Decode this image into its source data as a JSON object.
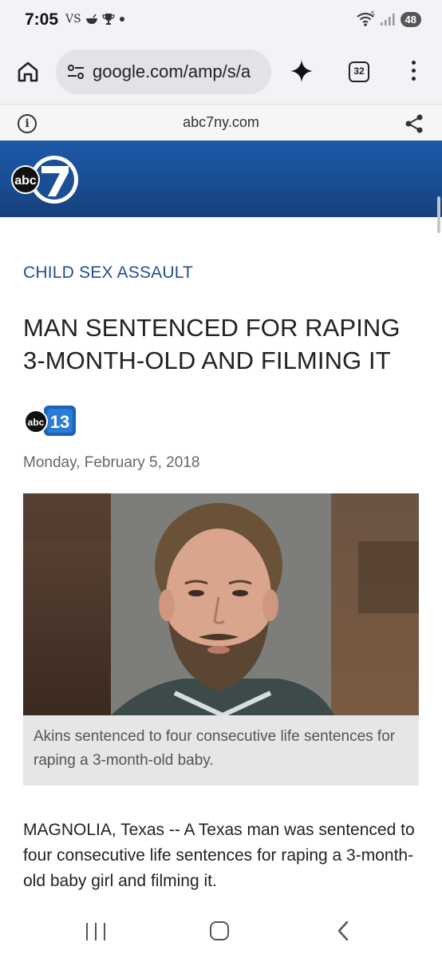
{
  "status": {
    "time": "7:05",
    "left_icons": "VS",
    "wifi_badge": "5",
    "battery": "48"
  },
  "browser": {
    "url": "google.com/amp/s/a",
    "tab_count": "32",
    "site_domain": "abc7ny.com"
  },
  "brand": {
    "logo_text": "abc",
    "logo_number": "7",
    "colors": {
      "header": "#1a4f95",
      "accent": "#1f4f8d"
    }
  },
  "article": {
    "category": "CHILD SEX ASSAULT",
    "headline": "MAN SENTENCED FOR RAPING 3-MONTH-OLD AND FILMING IT",
    "source_logo_text": "abc",
    "source_logo_number": "13",
    "date": "Monday, February 5, 2018",
    "caption": "Akins sentenced to four consecutive life sentences for raping a 3-month-old baby.",
    "body": "MAGNOLIA, Texas -- A Texas man was sentenced to four consecutive life sentences for raping a 3-month-old baby girl and filming it."
  },
  "icons": {
    "home": "home-icon",
    "tune": "site-settings-icon",
    "sparkle": "gemini-sparkle-icon",
    "menu": "more-vert-icon",
    "info": "info-icon",
    "share": "share-icon",
    "nav_recents": "recents-icon",
    "nav_home": "nav-home-icon",
    "nav_back": "back-icon"
  }
}
